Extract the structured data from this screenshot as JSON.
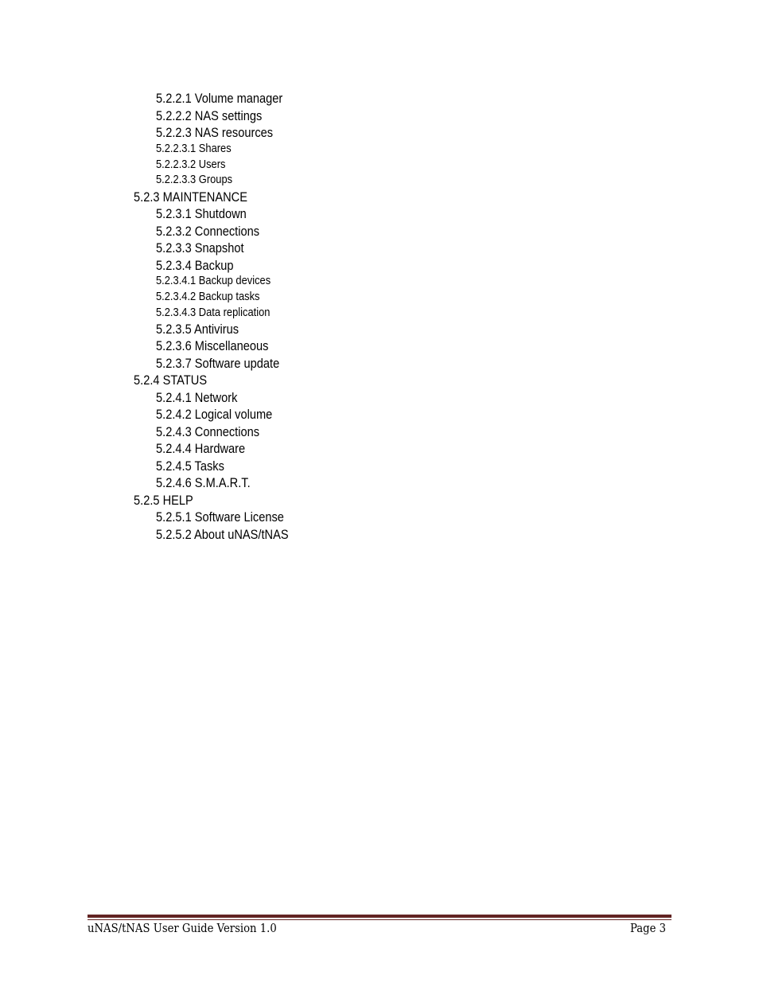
{
  "toc": {
    "entries": [
      {
        "text": "5.2.2.1 Volume manager",
        "level": 3
      },
      {
        "text": "5.2.2.2 NAS settings",
        "level": 3
      },
      {
        "text": "5.2.2.3 NAS resources",
        "level": 3
      },
      {
        "text": "5.2.2.3.1 Shares",
        "level": 4
      },
      {
        "text": "5.2.2.3.2 Users",
        "level": 4
      },
      {
        "text": "5.2.2.3.3 Groups",
        "level": 4
      },
      {
        "text": "5.2.3 MAINTENANCE",
        "level": 2
      },
      {
        "text": "5.2.3.1 Shutdown",
        "level": 3
      },
      {
        "text": "5.2.3.2 Connections",
        "level": 3
      },
      {
        "text": "5.2.3.3 Snapshot",
        "level": 3
      },
      {
        "text": "5.2.3.4 Backup",
        "level": 3
      },
      {
        "text": "5.2.3.4.1 Backup devices",
        "level": 4
      },
      {
        "text": "5.2.3.4.2 Backup tasks",
        "level": 4
      },
      {
        "text": "5.2.3.4.3 Data replication",
        "level": 4
      },
      {
        "text": "5.2.3.5 Antivirus",
        "level": 3
      },
      {
        "text": "5.2.3.6 Miscellaneous",
        "level": 3
      },
      {
        "text": "5.2.3.7 Software update",
        "level": 3
      },
      {
        "text": "5.2.4 STATUS",
        "level": 2
      },
      {
        "text": "5.2.4.1 Network",
        "level": 3
      },
      {
        "text": "5.2.4.2 Logical volume",
        "level": 3
      },
      {
        "text": "5.2.4.3 Connections",
        "level": 3
      },
      {
        "text": "5.2.4.4 Hardware",
        "level": 3
      },
      {
        "text": "5.2.4.5 Tasks",
        "level": 3
      },
      {
        "text": "5.2.4.6 S.M.A.R.T.",
        "level": 3
      },
      {
        "text": "5.2.5 HELP",
        "level": 2
      },
      {
        "text": "5.2.5.1 Software License",
        "level": 3
      },
      {
        "text": "5.2.5.2 About uNAS/tNAS",
        "level": 3
      }
    ]
  },
  "footer": {
    "title": "uNAS/tNAS User Guide Version 1.0",
    "page": "Page 3",
    "rule_color": "#622423"
  }
}
